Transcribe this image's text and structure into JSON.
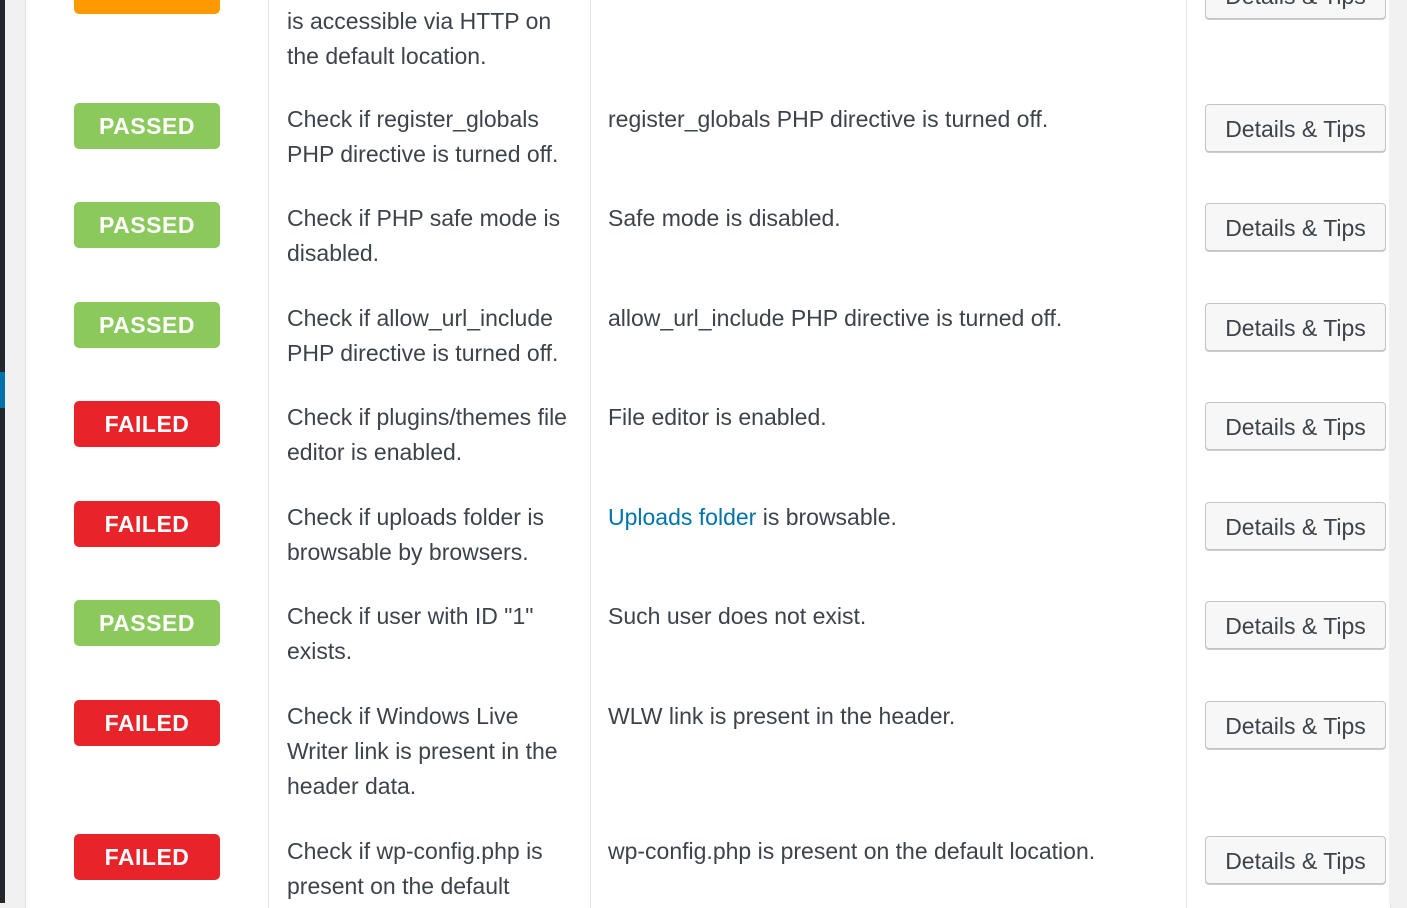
{
  "status_colors": {
    "passed": "#8bc95c",
    "failed": "#e9232a",
    "warning": "#ff9900"
  },
  "link_color": "#0073aa",
  "rows": [
    {
      "status": "warning",
      "badge": "",
      "description": "is accessible via HTTP on the default location.",
      "result_link": "",
      "result": "",
      "button": "Details & Tips"
    },
    {
      "status": "passed",
      "badge": "PASSED",
      "description": "Check if register_globals PHP directive is turned off.",
      "result_link": "",
      "result": "register_globals PHP directive is turned off.",
      "button": "Details & Tips"
    },
    {
      "status": "passed",
      "badge": "PASSED",
      "description": "Check if PHP safe mode is disabled.",
      "result_link": "",
      "result": "Safe mode is disabled.",
      "button": "Details & Tips"
    },
    {
      "status": "passed",
      "badge": "PASSED",
      "description": "Check if allow_url_include PHP directive is turned off.",
      "result_link": "",
      "result": "allow_url_include PHP directive is turned off.",
      "button": "Details & Tips"
    },
    {
      "status": "failed",
      "badge": "FAILED",
      "description": "Check if plugins/themes file editor is enabled.",
      "result_link": "",
      "result": "File editor is enabled.",
      "button": "Details & Tips"
    },
    {
      "status": "failed",
      "badge": "FAILED",
      "description": "Check if uploads folder is browsable by browsers.",
      "result_link": "Uploads folder",
      "result": " is browsable.",
      "button": "Details & Tips"
    },
    {
      "status": "passed",
      "badge": "PASSED",
      "description": "Check if user with ID \"1\" exists.",
      "result_link": "",
      "result": "Such user does not exist.",
      "button": "Details & Tips"
    },
    {
      "status": "failed",
      "badge": "FAILED",
      "description": "Check if Windows Live Writer link is present in the header data.",
      "result_link": "",
      "result": "WLW link is present in the header.",
      "button": "Details & Tips"
    },
    {
      "status": "failed",
      "badge": "FAILED",
      "description": "Check if wp-config.php is present on the default",
      "result_link": "",
      "result": "wp-config.php is present on the default location.",
      "button": "Details & Tips"
    }
  ]
}
